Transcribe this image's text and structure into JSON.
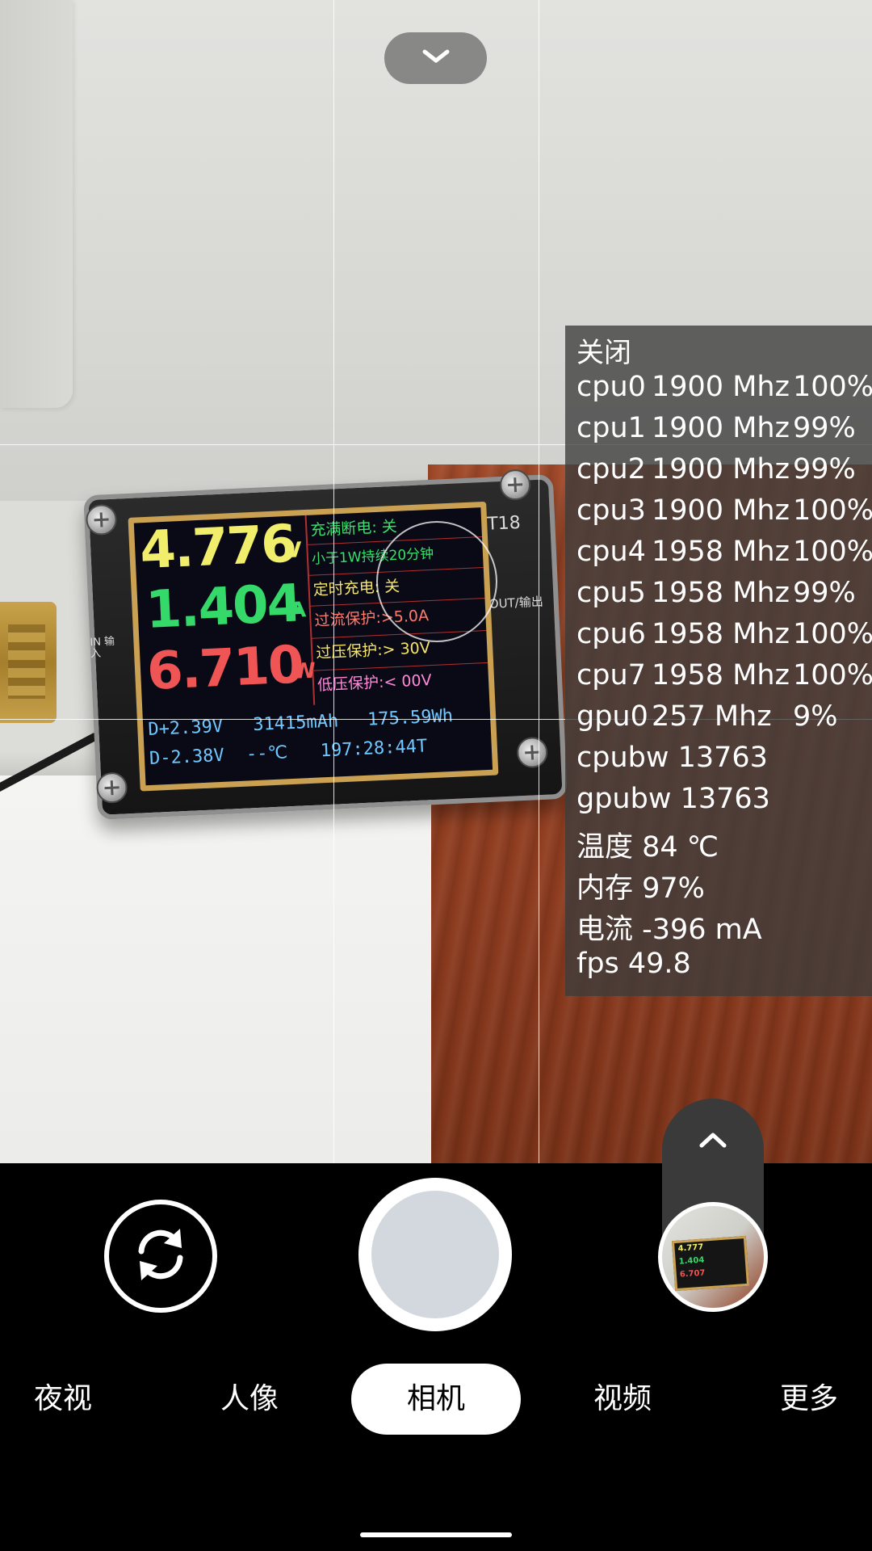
{
  "meter_display": {
    "voltage": "4.776",
    "voltage_unit": "V",
    "current": "1.404",
    "current_unit": "A",
    "power": "6.710",
    "power_unit": "W",
    "line_d_plus": "D+2.39V",
    "capacity": "31415mAh",
    "energy": "175.59Wh",
    "line_d_minus": "D-2.38V",
    "temperature": "--℃",
    "time": "197:28:44T",
    "settings": [
      "充满断电: 关",
      "小于1W持续20分钟",
      "定时充电: 关",
      "过流保护:>5.0A",
      "过压保护:> 30V",
      "低压保护:< 00V"
    ],
    "model": "T18",
    "in_label": "IN 输入",
    "out_label": "OUT/输出"
  },
  "perf_overlay": {
    "close_label": "关闭",
    "cpus": [
      {
        "name": "cpu0",
        "freq": "1900 Mhz",
        "pct": "100%"
      },
      {
        "name": "cpu1",
        "freq": "1900 Mhz",
        "pct": "99%"
      },
      {
        "name": "cpu2",
        "freq": "1900 Mhz",
        "pct": "99%"
      },
      {
        "name": "cpu3",
        "freq": "1900 Mhz",
        "pct": "100%"
      },
      {
        "name": "cpu4",
        "freq": "1958 Mhz",
        "pct": "100%"
      },
      {
        "name": "cpu5",
        "freq": "1958 Mhz",
        "pct": "99%"
      },
      {
        "name": "cpu6",
        "freq": "1958 Mhz",
        "pct": "100%"
      },
      {
        "name": "cpu7",
        "freq": "1958 Mhz",
        "pct": "100%"
      },
      {
        "name": "gpu0",
        "freq": "257 Mhz",
        "pct": "9%"
      }
    ],
    "cpubw": "cpubw 13763",
    "gpubw": "gpubw 13763",
    "temperature": "温度 84 ℃",
    "memory": "内存 97%",
    "current": "电流 -396 mA",
    "fps": "fps 49.8"
  },
  "thumbnail_preview": {
    "v": "4.777",
    "a": "1.404",
    "w": "6.707"
  },
  "modes": {
    "night": "夜视",
    "portrait": "人像",
    "camera": "相机",
    "video": "视频",
    "more": "更多"
  },
  "icons": {
    "top": "chevron-down-icon",
    "expand": "chevron-up-icon",
    "switch": "camera-switch-icon"
  },
  "colors": {
    "voltage": "#f0ee6a",
    "current": "#34d96a",
    "power": "#f05555",
    "info_blue": "#6fc7ff",
    "settings_green": "#39e06a",
    "settings_yellow": "#f4e56a",
    "settings_pink": "#ff88d8"
  }
}
